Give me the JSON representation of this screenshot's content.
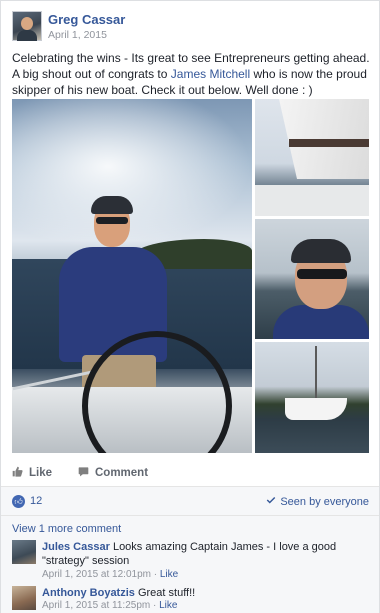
{
  "post": {
    "author": "Greg Cassar",
    "date": "April 1, 2015",
    "text_before": "Celebrating the wins - Its great to see Entrepreneurs getting ahead. A big shout out of congrats to ",
    "tagged_name": "James Mitchell",
    "text_after": " who is now the proud skipper of his new boat. Check it out below. Well done : )"
  },
  "actions": {
    "like": "Like",
    "comment": "Comment"
  },
  "stats": {
    "like_count": "12",
    "seen_label": "Seen by everyone"
  },
  "comments": {
    "view_more": "View 1 more comment",
    "items": [
      {
        "name": "Jules Cassar",
        "text": " Looks amazing Captain James - I love a good \"strategy\" session",
        "timestamp": "April 1, 2015 at 12:01pm",
        "like": "Like"
      },
      {
        "name": "Anthony Boyatzis",
        "text": " Great stuff!!",
        "timestamp": "April 1, 2015 at 11:25pm",
        "like": "Like"
      }
    ]
  },
  "icons": {
    "like_action": "thumbs-up-icon",
    "comment_action": "speech-bubble-icon",
    "like_badge": "thumbs-up-badge-icon",
    "seen": "globe-icon"
  },
  "colors": {
    "link": "#365899",
    "meta": "#90949c",
    "like_badge": "#4267b2",
    "stats_bg": "#f6f7f9"
  }
}
